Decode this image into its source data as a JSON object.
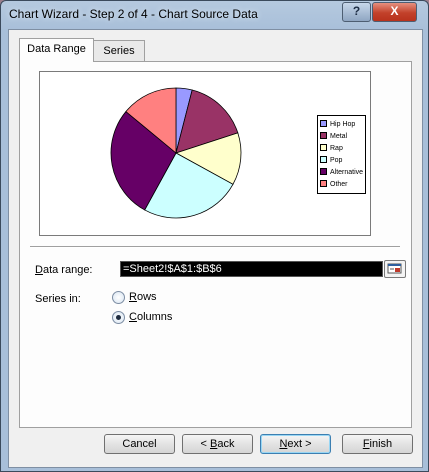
{
  "window": {
    "title": "Chart Wizard - Step 2 of 4 - Chart Source Data",
    "help_label": "?",
    "close_label": "X"
  },
  "tabs": [
    {
      "label": "Data Range",
      "selected": true
    },
    {
      "label": "Series",
      "selected": false
    }
  ],
  "chart_data": {
    "type": "pie",
    "categories": [
      "Hip Hop",
      "Metal",
      "Rap",
      "Pop",
      "Alternative",
      "Other"
    ],
    "values": [
      4,
      16,
      13,
      25,
      28,
      14
    ],
    "colors": [
      "#9999ff",
      "#993366",
      "#ffffcc",
      "#ccffff",
      "#660066",
      "#ff8080"
    ],
    "title": "",
    "legend": "right"
  },
  "legend_items": [
    {
      "label": "Hip Hop",
      "color": "#9999ff"
    },
    {
      "label": "Metal",
      "color": "#993366"
    },
    {
      "label": "Rap",
      "color": "#ffffcc"
    },
    {
      "label": "Pop",
      "color": "#ccffff"
    },
    {
      "label": "Alternative",
      "color": "#660066"
    },
    {
      "label": "Other",
      "color": "#ff8080"
    }
  ],
  "data_range": {
    "label_prefix": "D",
    "label_rest": "ata range:",
    "value": "=Sheet2!$A$1:$B$6"
  },
  "series_in": {
    "label": "Series in:",
    "rows": {
      "prefix": "R",
      "rest": "ows",
      "checked": false
    },
    "columns": {
      "prefix": "C",
      "rest": "olumns",
      "checked": true
    }
  },
  "buttons": {
    "cancel": "Cancel",
    "back_pre": "< ",
    "back_key": "B",
    "back_rest": "ack",
    "next_key": "N",
    "next_rest": "ext >",
    "finish_key": "F",
    "finish_rest": "inish"
  }
}
